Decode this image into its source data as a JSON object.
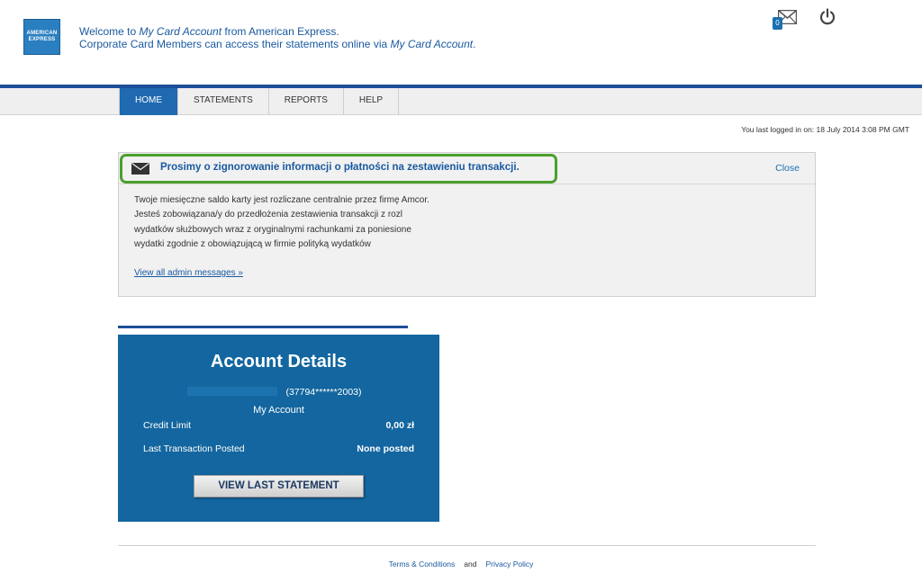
{
  "brand": {
    "logo_text": "AMERICAN EXPRESS",
    "accent": "#1e4f98"
  },
  "header": {
    "welcome_prefix": "Welcome to ",
    "welcome_em": "My Card Account",
    "welcome_suffix": " from American Express.",
    "line2_prefix": "Corporate Card Members can access their statements online via ",
    "line2_em": "My Card Account",
    "line2_suffix": "."
  },
  "mail": {
    "icon": "envelope-icon",
    "badge": "0"
  },
  "power": {
    "icon": "power-icon"
  },
  "nav": {
    "tabs": [
      "HOME",
      "STATEMENTS",
      "REPORTS",
      "HELP"
    ],
    "active": "HOME"
  },
  "last_login": "You last logged in on: 18 July 2014 3:08 PM GMT",
  "message": {
    "title": "Prosimy o zignorowanie informacji o płatności na zestawieniu transakcji.",
    "close": "Close",
    "lines": [
      "Twoje miesięczne saldo karty jest rozliczane centralnie przez firmę Amcor.",
      "Jesteś zobowiązana/y do przedłożenia zestawienia transakcji z rozl",
      "wydatków służbowych wraz z oryginalnymi rachunkami za poniesione",
      "wydatki zgodnie z obowiązującą w firmie polityką wydatków"
    ],
    "view_all": "View all admin messages »"
  },
  "account": {
    "title": "Account Details",
    "number": "(37794******2003)",
    "name": "My Account",
    "credit_limit_label": "Credit Limit",
    "credit_limit_value": "0,00 zł",
    "last_txn_label": "Last Transaction Posted",
    "last_txn_value": "None posted",
    "button": "VIEW LAST STATEMENT"
  },
  "footer": {
    "terms": "Terms & Conditions",
    "and": "and",
    "privacy": "Privacy Policy"
  }
}
